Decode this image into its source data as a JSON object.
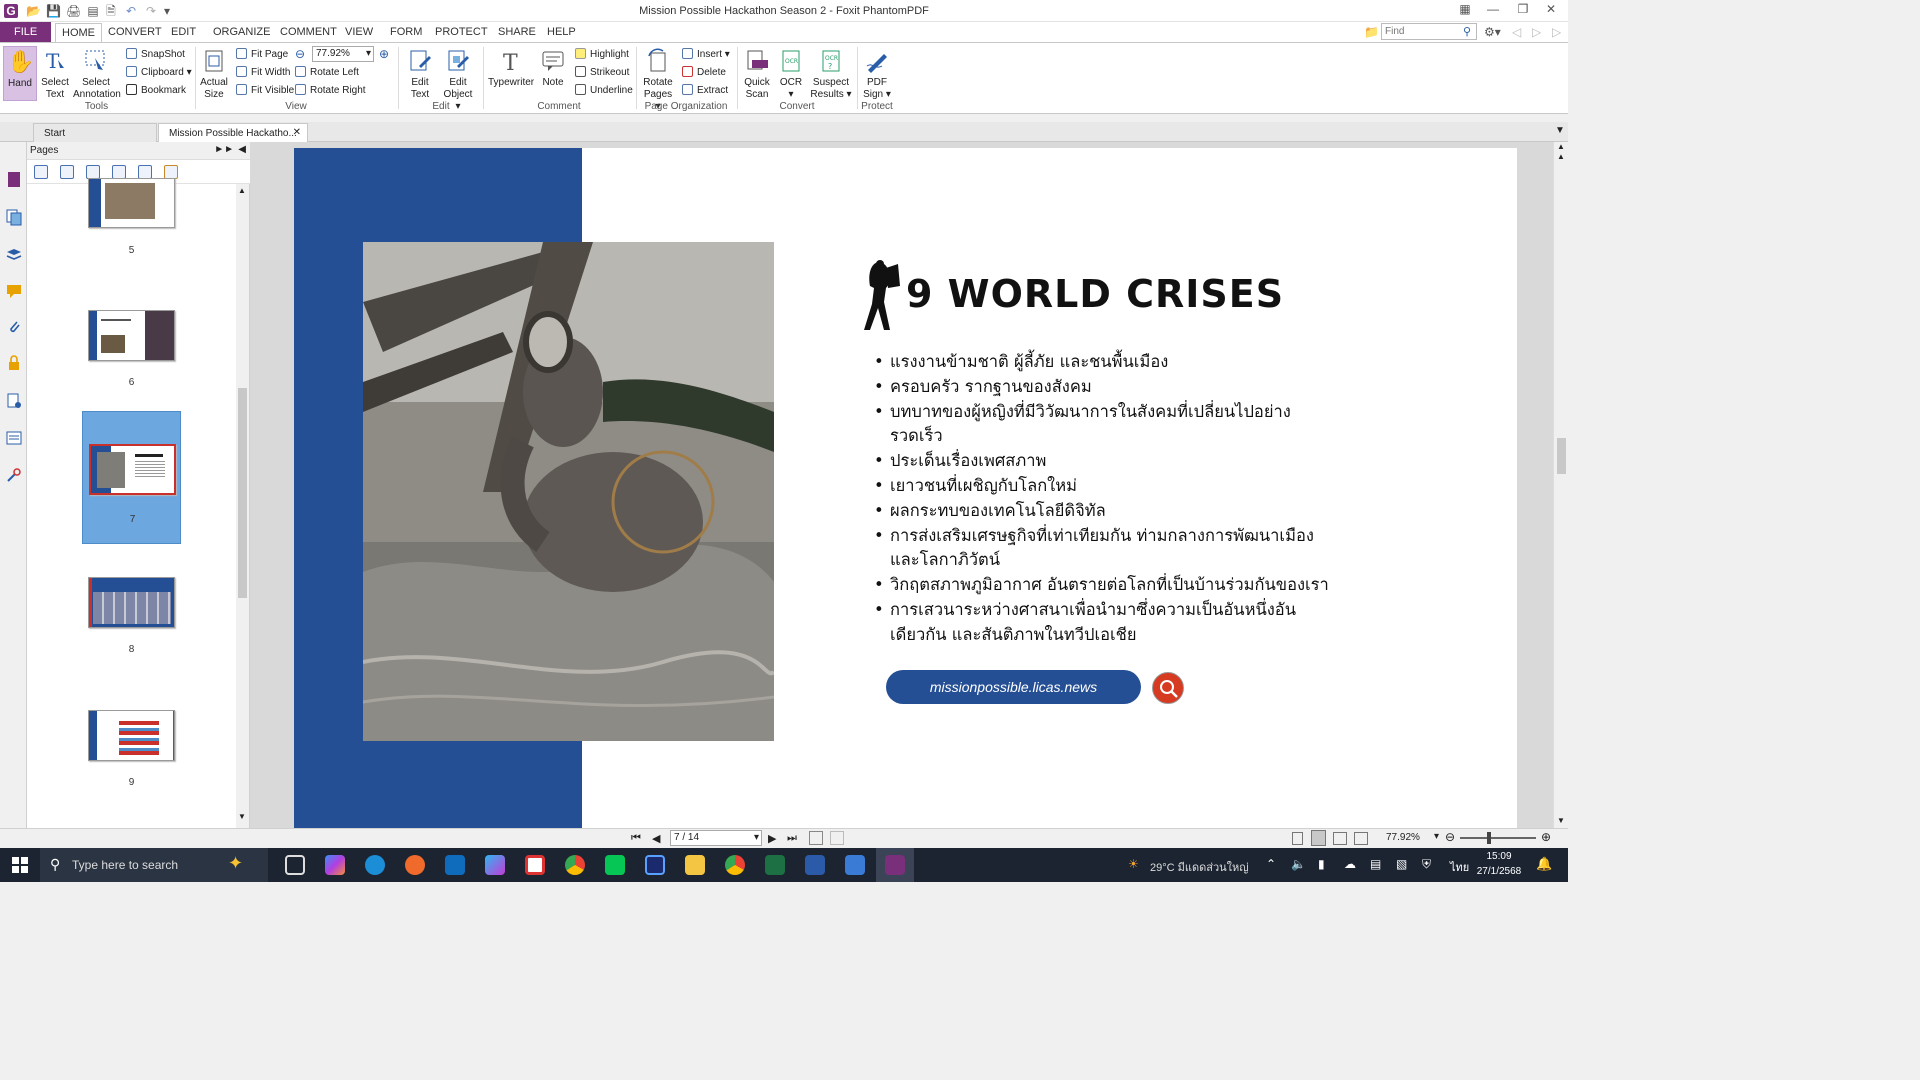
{
  "window": {
    "title": "Mission Possible Hackathon Season 2 - Foxit PhantomPDF",
    "find_placeholder": "Find"
  },
  "ribbon_tabs": [
    "FILE",
    "HOME",
    "CONVERT",
    "EDIT",
    "ORGANIZE",
    "COMMENT",
    "VIEW",
    "FORM",
    "PROTECT",
    "SHARE",
    "HELP"
  ],
  "ribbon": {
    "tools": {
      "hand": "Hand",
      "select_text_1": "Select",
      "select_text_2": "Text",
      "select_annotation_1": "Select",
      "select_annotation_2": "Annotation",
      "snapshot": "SnapShot",
      "clipboard": "Clipboard",
      "bookmark": "Bookmark",
      "group": "Tools"
    },
    "view": {
      "actual_size_1": "Actual",
      "actual_size_2": "Size",
      "fit_page": "Fit Page",
      "fit_width": "Fit Width",
      "fit_visible": "Fit Visible",
      "zoom": "77.92%",
      "rotate_left": "Rotate Left",
      "rotate_right": "Rotate Right",
      "group": "View"
    },
    "edit": {
      "edit_text_1": "Edit",
      "edit_text_2": "Text",
      "edit_object_1": "Edit",
      "edit_object_2": "Object",
      "group": "Edit"
    },
    "comment": {
      "typewriter": "Typewriter",
      "note": "Note",
      "highlight": "Highlight",
      "strikeout": "Strikeout",
      "underline": "Underline",
      "group": "Comment"
    },
    "page_org": {
      "rotate_pages_1": "Rotate",
      "rotate_pages_2": "Pages",
      "insert": "Insert",
      "delete": "Delete",
      "extract": "Extract",
      "group": "Page Organization"
    },
    "convert": {
      "quick_scan_1": "Quick",
      "quick_scan_2": "Scan",
      "ocr": "OCR",
      "suspect_1": "Suspect",
      "suspect_2": "Results",
      "group": "Convert"
    },
    "protect": {
      "pdf_sign_1": "PDF",
      "pdf_sign_2": "Sign",
      "group": "Protect"
    }
  },
  "doc_tabs": [
    "Start",
    "Mission Possible Hackatho..."
  ],
  "pages_panel": {
    "title": "Pages",
    "thumbnails": [
      {
        "label": "5"
      },
      {
        "label": "6"
      },
      {
        "label": "7"
      },
      {
        "label": "8"
      },
      {
        "label": "9"
      }
    ],
    "selected": "7"
  },
  "document": {
    "heading": "9 WORLD CRISES",
    "bullets": [
      "แรงงานข้ามชาติ ผู้ลี้ภัย และชนพื้นเมือง",
      "ครอบครัว รากฐานของสังคม",
      "บทบาทของผู้หญิงที่มีวิวัฒนาการในสังคมที่เปลี่ยนไปอย่างรวดเร็ว",
      "ประเด็นเรื่องเพศสภาพ",
      "เยาวชนที่เผชิญกับโลกใหม่",
      "ผลกระทบของเทคโนโลยีดิจิทัล",
      "การส่งเสริมเศรษฐกิจที่เท่าเทียมกัน ท่ามกลางการพัฒนาเมืองและโลกาภิวัตน์",
      "วิกฤตสภาพภูมิอากาศ อันตรายต่อโลกที่เป็นบ้านร่วมกันของเรา",
      "การเสวนาระหว่างศาสนาเพื่อนำมาซึ่งความเป็นอันหนึ่งอันเดียวกัน และสันติภาพในทวีปเอเชีย"
    ],
    "url": "missionpossible.licas.news"
  },
  "statusbar": {
    "page_indicator": "7 / 14",
    "zoom": "77.92%"
  },
  "taskbar": {
    "search_placeholder": "Type here to search",
    "weather": "29°C มีแดดส่วนใหญ่",
    "language": "ไทย",
    "time": "15:09",
    "date": "27/1/2568"
  },
  "colors": {
    "brand_purple": "#7a2f7a",
    "page_blue": "#254f95",
    "search_red": "#d63a21",
    "selection_blue": "#6da7df"
  }
}
